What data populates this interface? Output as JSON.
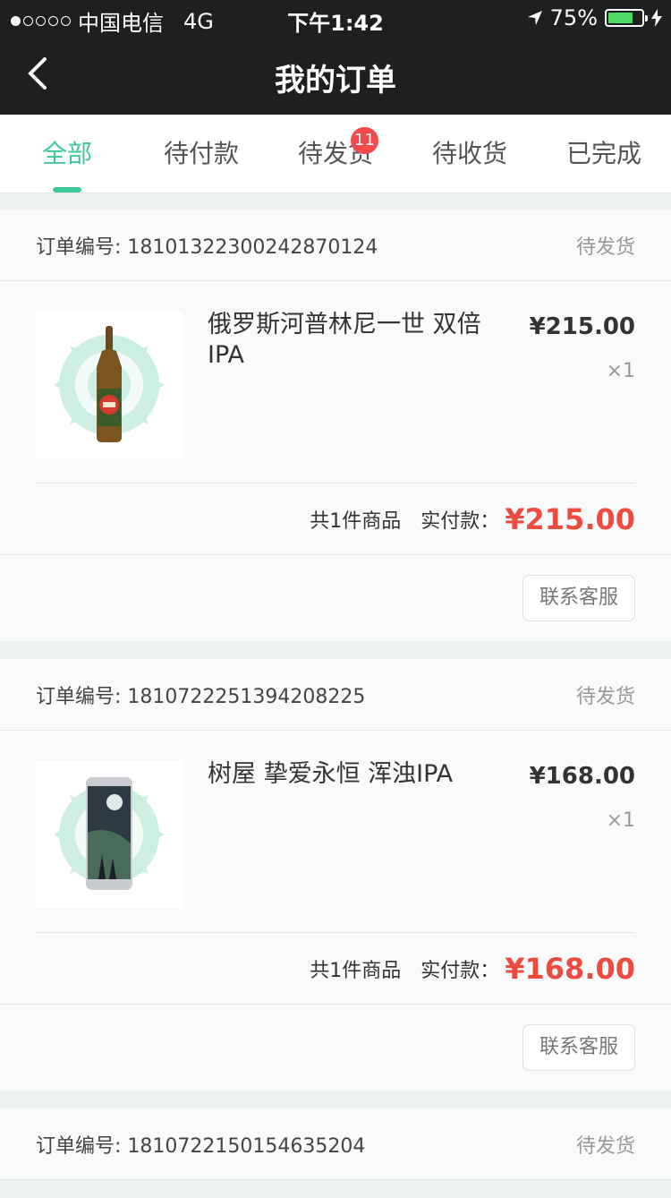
{
  "status": {
    "signal_dots": [
      true,
      false,
      false,
      false,
      false
    ],
    "carrier": "中国电信",
    "network": "4G",
    "time": "下午1:42",
    "battery": "75%",
    "battery_level": 0.75
  },
  "nav": {
    "title": "我的订单"
  },
  "tabs": [
    {
      "label": "全部",
      "active": true
    },
    {
      "label": "待付款",
      "active": false
    },
    {
      "label": "待发货",
      "active": false,
      "badge": "11"
    },
    {
      "label": "待收货",
      "active": false
    },
    {
      "label": "已完成",
      "active": false
    }
  ],
  "orders": [
    {
      "order_label": "订单编号: ",
      "order_no": "1810132230024287012​4",
      "status": "待发货",
      "item_name": "俄罗斯河普林尼一世 双倍IPA",
      "price": "¥215.00",
      "qty": "×1",
      "count_text": "共1件商品",
      "paid_label": "实付款：",
      "paid": "¥215.00",
      "button": "联系客服",
      "bottle": "bottle"
    },
    {
      "order_label": "订单编号: ",
      "order_no": "181072225139420822​5",
      "status": "待发货",
      "item_name": "树屋 挚爱永恒 浑浊IPA",
      "price": "¥168.00",
      "qty": "×1",
      "count_text": "共1件商品",
      "paid_label": "实付款：",
      "paid": "¥168.00",
      "button": "联系客服",
      "bottle": "can"
    },
    {
      "order_label": "订单编号: ",
      "order_no": "1810722150154635204",
      "status": "待发货"
    }
  ]
}
